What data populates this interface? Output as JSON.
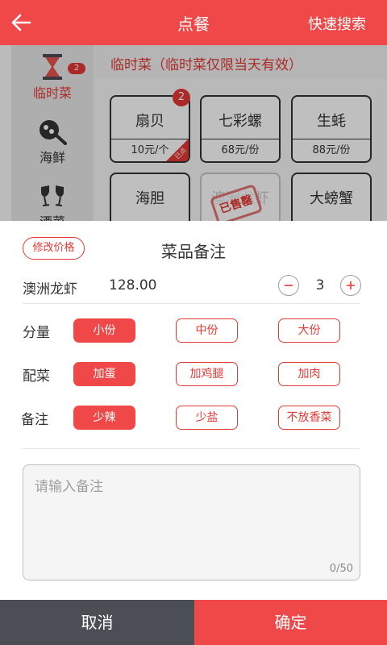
{
  "colors": {
    "accent": "#f04848",
    "red_text": "#e53935",
    "cancel_bg": "#4b4e55"
  },
  "topbar": {
    "title": "点餐",
    "search": "快速搜索",
    "back_icon": "arrow-left-icon"
  },
  "sidebar": {
    "items": [
      {
        "label": "临时菜",
        "icon": "hourglass-icon",
        "badge": "2",
        "active": true
      },
      {
        "label": "海鲜",
        "icon": "frying-pan-icon"
      },
      {
        "label": "酒菜",
        "icon": "wine-glasses-icon"
      }
    ]
  },
  "category": {
    "header": "临时菜（临时菜仅限当天有效）"
  },
  "dishes": [
    {
      "name": "扇贝",
      "price": "10元/个",
      "badge": "2",
      "corner_tag": "已点"
    },
    {
      "name": "七彩螺",
      "price": "68元/份"
    },
    {
      "name": "生蚝",
      "price": "88元/份"
    },
    {
      "name": "海胆"
    },
    {
      "name": "澳洲龙虾",
      "stamp": "已售罄",
      "sold_out": true
    },
    {
      "name": "大螃蟹"
    }
  ],
  "sheet": {
    "edit_price": "修改价格",
    "title": "菜品备注",
    "dish_name": "澳洲龙虾",
    "dish_price": "128.00",
    "quantity": "3",
    "rows": [
      {
        "label": "分量",
        "options": [
          "小份",
          "中份",
          "大份"
        ],
        "selected": 0
      },
      {
        "label": "配菜",
        "options": [
          "加蛋",
          "加鸡腿",
          "加肉"
        ],
        "selected": 0
      },
      {
        "label": "备注",
        "options": [
          "少辣",
          "少盐",
          "不放香菜"
        ],
        "selected": 0
      }
    ],
    "note_placeholder": "请输入备注",
    "note_counter": "0/50"
  },
  "footer": {
    "cancel": "取消",
    "confirm": "确定"
  }
}
